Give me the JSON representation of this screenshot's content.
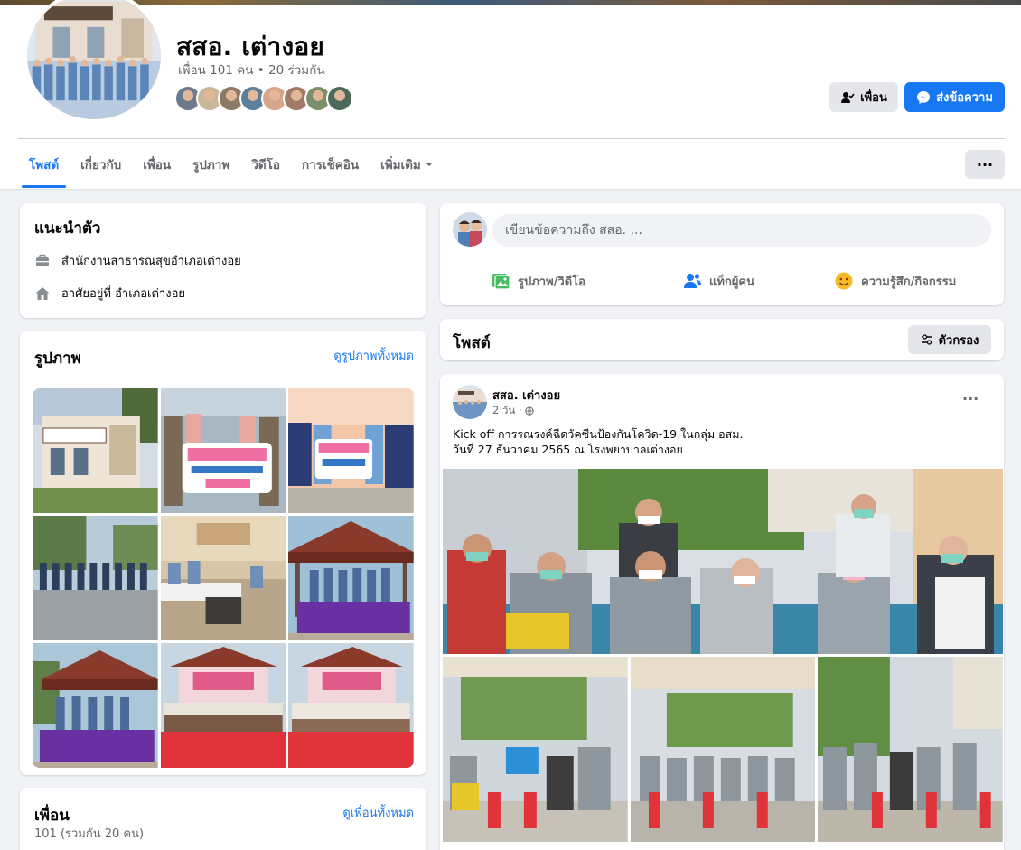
{
  "page": {
    "name": "สสอ. เต่างอย",
    "friend_summary": "เพื่อน 101 คน • 20 ร่วมกัน",
    "mutual_avatar_colors": [
      "#6b7a8f",
      "#c9b79c",
      "#8a7a66",
      "#5e7f99",
      "#d7a58a",
      "#a27a6a",
      "#7b8f6b",
      "#4c6a5a"
    ]
  },
  "actions": {
    "friend_label": "เพื่อน",
    "message_label": "ส่งข้อความ",
    "more_label": "···"
  },
  "tabs": [
    {
      "label": "โพสต์",
      "active": true
    },
    {
      "label": "เกี่ยวกับ",
      "active": false
    },
    {
      "label": "เพื่อน",
      "active": false
    },
    {
      "label": "รูปภาพ",
      "active": false
    },
    {
      "label": "วิดีโอ",
      "active": false
    },
    {
      "label": "การเช็คอิน",
      "active": false
    },
    {
      "label": "เพิ่มเติม",
      "active": false
    }
  ],
  "intro": {
    "title": "แนะนำตัว",
    "workplace": "สำนักงานสาธารณสุขอำเภอเต่างอย",
    "lives_in": "อาศัยอยู่ที่ อำเภอเต่างอย"
  },
  "photos": {
    "title": "รูปภาพ",
    "see_all": "ดูรูปภาพทั้งหมด"
  },
  "friends": {
    "title": "เพื่อน",
    "count": "101 (ร่วมกัน 20 คน)",
    "see_all": "ดูเพื่อนทั้งหมด"
  },
  "composer": {
    "placeholder": "เขียนข้อความถึง สสอ. ...",
    "photo_video": "รูปภาพ/วิดีโอ",
    "tag_people": "แท็กผู้คน",
    "feeling": "ความรู้สึก/กิจกรรม"
  },
  "posts_header": {
    "title": "โพสต์",
    "filter_label": "ตัวกรอง"
  },
  "post": {
    "author": "สสอ. เต่างอย",
    "time": "2 วัน ·",
    "menu": "···",
    "line1": "Kick off การรณรงค์ฉีดวัคซีนป้องกันโควิด-19 ในกลุ่ม อสม.",
    "line2": "วันที่ 27 ธันวาคม 2565 ณ โรงพยาบาลเต่างอย"
  },
  "colors": {
    "accent": "#1877f2",
    "background": "#f0f2f5",
    "secondary_text": "#65676b"
  }
}
